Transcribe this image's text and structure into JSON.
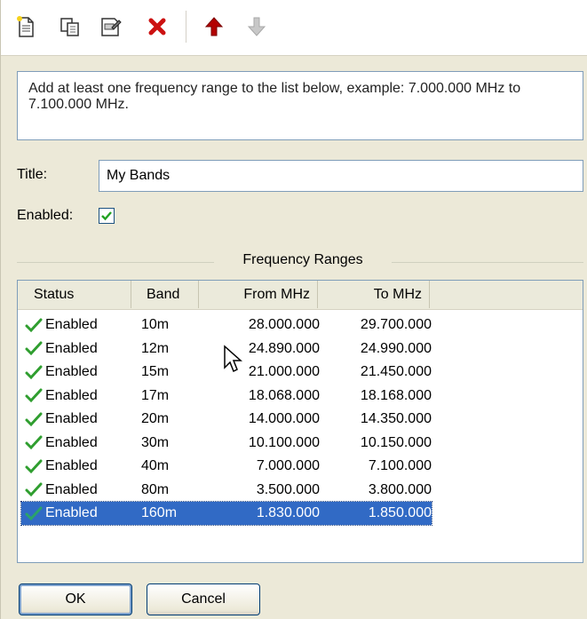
{
  "toolbar": {
    "buttons": [
      {
        "icon": "new-document-icon"
      },
      {
        "icon": "copy-icon"
      },
      {
        "icon": "properties-icon"
      },
      {
        "icon": "delete-icon"
      },
      {
        "icon": "move-up-icon"
      },
      {
        "icon": "move-down-icon"
      }
    ]
  },
  "instruction": "Add at least one frequency range to the list below, example: 7.000.000 MHz to 7.100.000 MHz.",
  "form": {
    "title_label": "Title:",
    "title_value": "My Bands",
    "enabled_label": "Enabled:",
    "enabled_checked": true
  },
  "group_title": "Frequency Ranges",
  "list": {
    "columns": [
      "Status",
      "Band",
      "From MHz",
      "To MHz"
    ],
    "rows": [
      {
        "status": "Enabled",
        "band": "10m",
        "from": "28.000.000",
        "to": "29.700.000"
      },
      {
        "status": "Enabled",
        "band": "12m",
        "from": "24.890.000",
        "to": "24.990.000"
      },
      {
        "status": "Enabled",
        "band": "15m",
        "from": "21.000.000",
        "to": "21.450.000"
      },
      {
        "status": "Enabled",
        "band": "17m",
        "from": "18.068.000",
        "to": "18.168.000"
      },
      {
        "status": "Enabled",
        "band": "20m",
        "from": "14.000.000",
        "to": "14.350.000"
      },
      {
        "status": "Enabled",
        "band": "30m",
        "from": "10.100.000",
        "to": "10.150.000"
      },
      {
        "status": "Enabled",
        "band": "40m",
        "from": "7.000.000",
        "to": "7.100.000"
      },
      {
        "status": "Enabled",
        "band": "80m",
        "from": "3.500.000",
        "to": "3.800.000"
      },
      {
        "status": "Enabled",
        "band": "160m",
        "from": "1.830.000",
        "to": "1.850.000"
      }
    ],
    "selected_row": 8
  },
  "buttons": {
    "ok": "OK",
    "cancel": "Cancel"
  },
  "colors": {
    "selection": "#316ac5",
    "check_green": "#2f9e2f",
    "delete_red": "#cc1111",
    "arrow_up": "#b30000"
  }
}
